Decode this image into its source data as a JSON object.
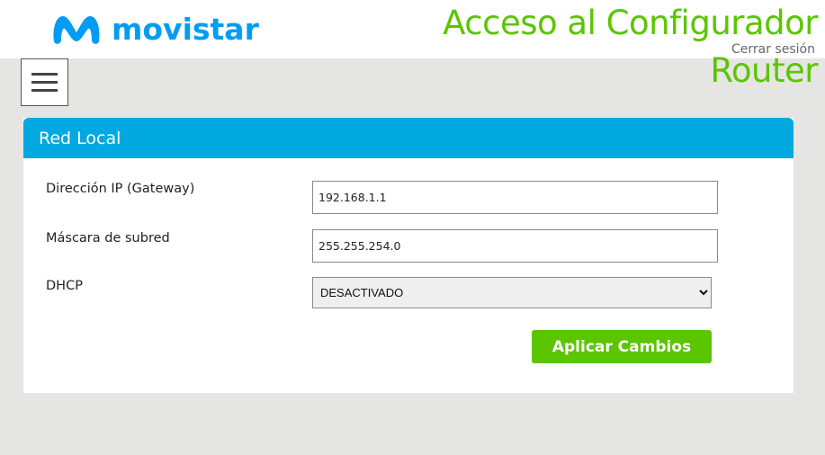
{
  "header": {
    "brand": "movistar",
    "title_line1": "Acceso al Configurador",
    "title_line2": "Router",
    "logout_label": "Cerrar sesión",
    "brand_color": "#019df4",
    "title_color": "#5bc500"
  },
  "menu": {
    "icon": "hamburger-menu-icon"
  },
  "panel": {
    "title": "Red Local",
    "header_color": "#00a9e0",
    "fields": {
      "ip_label": "Dirección IP (Gateway)",
      "ip_value": "192.168.1.1",
      "mask_label": "Máscara de subred",
      "mask_value": "255.255.254.0",
      "dhcp_label": "DHCP",
      "dhcp_selected": "DESACTIVADO"
    },
    "apply_label": "Aplicar Cambios",
    "apply_color": "#5bc500"
  }
}
